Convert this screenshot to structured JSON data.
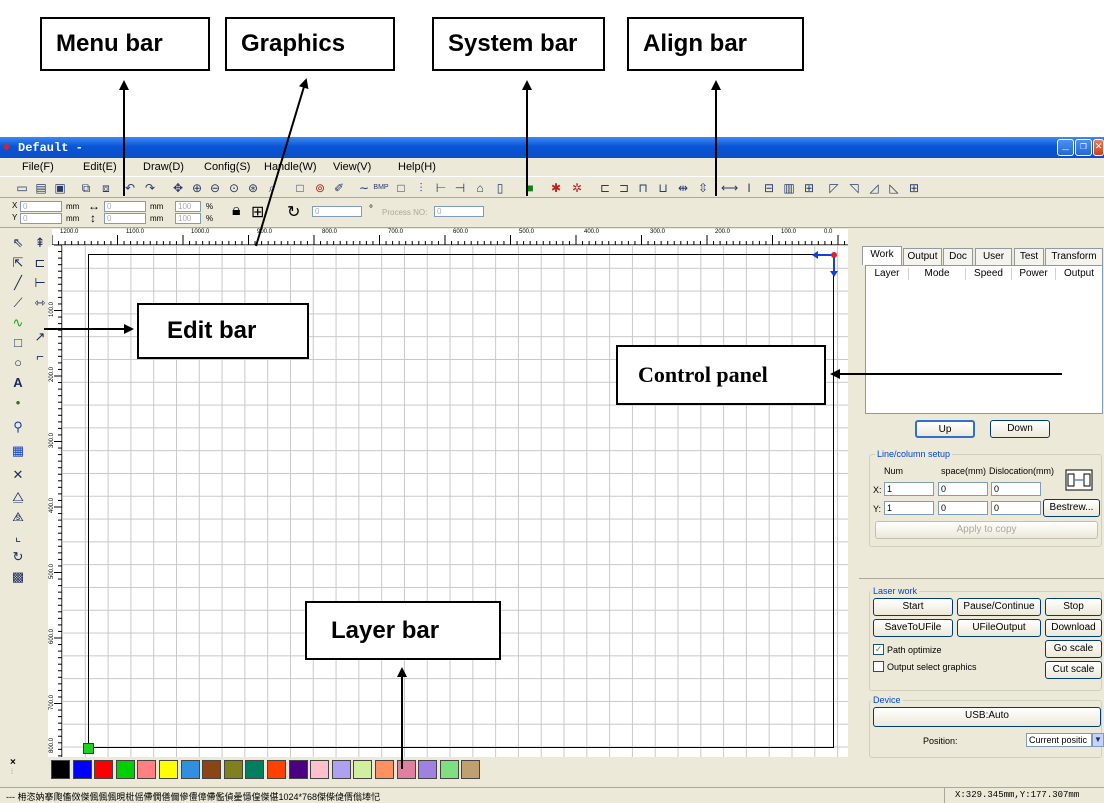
{
  "callouts": {
    "menu_bar": "Menu bar",
    "graphics": "Graphics",
    "system_bar": "System bar",
    "align_bar": "Align bar",
    "edit_bar": "Edit bar",
    "control_panel": "Control panel",
    "layer_bar": "Layer bar"
  },
  "window": {
    "title": "Default -",
    "app_icon": "app-logo-icon",
    "controls": [
      "minimize-icon",
      "restore-icon",
      "close-icon"
    ]
  },
  "menu": [
    "File(F)",
    "Edit(E)",
    "Draw(D)",
    "Config(S)",
    "Handle(W)",
    "View(V)",
    "Help(H)"
  ],
  "toolbar": {
    "icons": [
      "new-icon",
      "open-icon",
      "save-icon",
      "import-icon",
      "export-icon",
      "undo-icon",
      "redo-icon",
      "pointer-icon",
      "zoom-in-icon",
      "zoom-out-icon",
      "zoom-page-icon",
      "zoom-select-icon",
      "zoom-all-icon",
      "rectangle-icon",
      "ellipse-icon",
      "freehand-icon",
      "curve-icon",
      "bmp-icon",
      "frame-icon",
      "group-icon",
      "distribute-h-icon",
      "distribute-v-icon",
      "simulate-icon",
      "data-icon",
      "output-icon",
      "laser-settings-icon",
      "layer-settings-icon",
      "align-left-icon",
      "align-right-icon",
      "align-top-icon",
      "align-bottom-icon",
      "center-h-icon",
      "center-v-icon",
      "same-width-icon",
      "same-height-icon",
      "same-size-icon",
      "space-h-icon",
      "space-v-icon",
      "corner-tl-icon",
      "corner-tr-icon",
      "corner-br-icon",
      "corner-bl-icon",
      "center-icon"
    ],
    "bmp_label": "BMP"
  },
  "coords": {
    "x_label": "X",
    "y_label": "Y",
    "x_value": "0",
    "y_value": "0",
    "unit": "mm",
    "w_value": "0",
    "h_value": "0",
    "scale_x": "100",
    "scale_y": "100",
    "percent": "%",
    "rotate_value": "0",
    "degree": "°",
    "process_label": "Process NO:",
    "process_value": "0"
  },
  "edit_bar": {
    "icons": [
      "select-icon",
      "node-edit-icon",
      "line-icon",
      "polyline-icon",
      "curve-draw-icon",
      "rectangle-draw-icon",
      "ellipse-draw-icon",
      "text-icon",
      "dot-icon",
      "bitmap-icon",
      "array-icon",
      "delete-icon",
      "mirror-h-icon",
      "mirror-v-icon",
      "align-icon",
      "rotate-icon",
      "grid-array-icon",
      "origin-icon",
      "h-distance-icon",
      "v-distance-icon",
      "h-line-icon",
      "free-line-icon"
    ]
  },
  "rulers": {
    "h_ticks": [
      "1200.0",
      "1100.0",
      "1000.0",
      "900.0",
      "800.0",
      "700.0",
      "600.0",
      "500.0",
      "400.0",
      "300.0",
      "200.0",
      "100.0",
      "0.0"
    ],
    "v_ticks": [
      "100.0",
      "200.0",
      "300.0",
      "400.0",
      "500.0",
      "600.0",
      "700.0",
      "800.0"
    ]
  },
  "panel": {
    "tabs": [
      "Work",
      "Output",
      "Doc",
      "User",
      "Test",
      "Transform"
    ],
    "active_tab": "Work",
    "layer_columns": [
      "Layer",
      "Mode",
      "Speed",
      "Power",
      "Output"
    ],
    "up": "Up",
    "down": "Down",
    "line_column": {
      "title": "Line/column setup",
      "num": "Num",
      "space": "space(mm)",
      "dislocation": "Dislocation(mm)",
      "x_label": "X:",
      "y_label": "Y:",
      "x_num": "1",
      "x_space": "0",
      "x_disloc": "0",
      "y_num": "1",
      "y_space": "0",
      "y_disloc": "0",
      "bestrew": "Bestrew...",
      "apply": "Apply to copy"
    },
    "laser_work": {
      "title": "Laser work",
      "start": "Start",
      "pause": "Pause/Continue",
      "stop": "Stop",
      "save_ufile": "SaveToUFile",
      "ufile_output": "UFileOutput",
      "download": "Download",
      "path_optimize": "Path optimize",
      "path_optimize_checked": true,
      "output_select": "Output select graphics",
      "output_select_checked": false,
      "go_scale": "Go scale",
      "cut_scale": "Cut scale"
    },
    "device": {
      "title": "Device",
      "usb": "USB:Auto",
      "position_label": "Position:",
      "position_value": "Current positic"
    }
  },
  "palette": [
    "#000000",
    "#0000ff",
    "#ff0000",
    "#00d000",
    "#ff8080",
    "#ffff00",
    "#3090e0",
    "#8b4513",
    "#808020",
    "#008060",
    "#ff4000",
    "#4b0082",
    "#ffc0cb",
    "#b0a0f0",
    "#d0f0a0",
    "#ff9060",
    "#e080a0",
    "#a080e0",
    "#80e080",
    "#c0a070"
  ],
  "status": {
    "left": "--- 枏恣妠搴爮傗傚傑偑偑偑晛梉傜僀僩僐儞傪僼傽僀儖偵曐懚偟傑偡1024*768傑偨偼偦傟埲忋",
    "coords": "X:329.345mm,Y:177.307mm"
  }
}
